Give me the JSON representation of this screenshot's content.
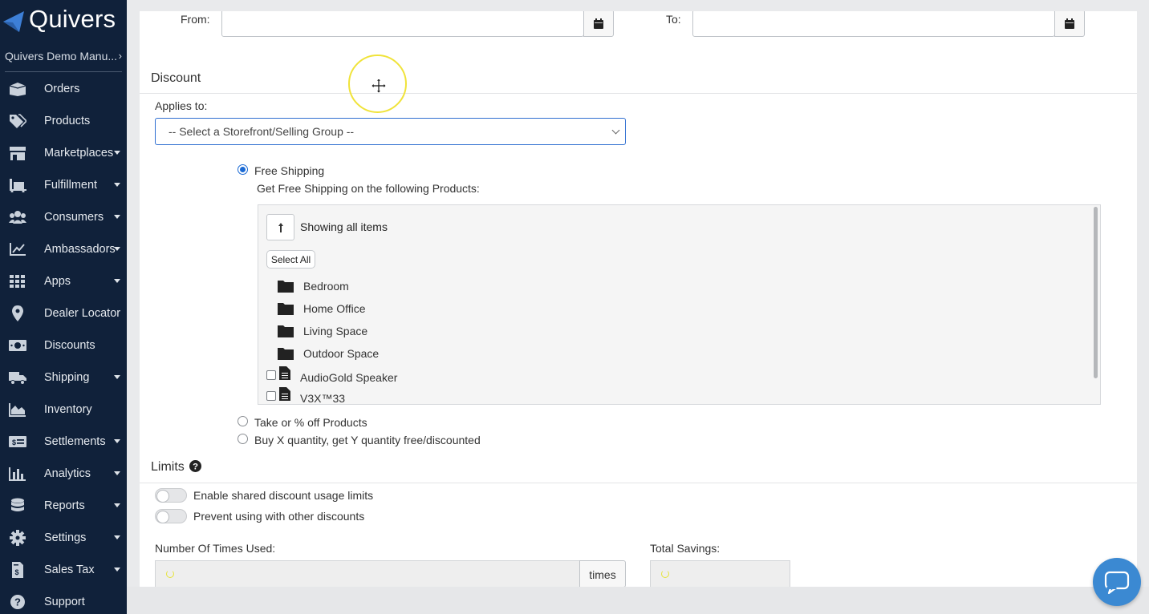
{
  "app": {
    "name": "Quivers",
    "account": "Quivers Demo Manu...",
    "account_chevron": "›"
  },
  "nav": [
    {
      "label": "Orders",
      "icon": "box-open-icon",
      "caret": false
    },
    {
      "label": "Products",
      "icon": "tags-icon",
      "caret": false
    },
    {
      "label": "Marketplaces",
      "icon": "store-icon",
      "caret": true
    },
    {
      "label": "Fulfillment",
      "icon": "pallet-icon",
      "caret": true
    },
    {
      "label": "Consumers",
      "icon": "users-icon",
      "caret": true
    },
    {
      "label": "Ambassadors",
      "icon": "chart-line-icon",
      "caret": true
    },
    {
      "label": "Apps",
      "icon": "grid-icon",
      "caret": true
    },
    {
      "label": "Dealer Locator",
      "icon": "map-pin-icon",
      "caret": false
    },
    {
      "label": "Discounts",
      "icon": "money-bill-icon",
      "caret": false
    },
    {
      "label": "Shipping",
      "icon": "truck-icon",
      "caret": true
    },
    {
      "label": "Inventory",
      "icon": "area-chart-icon",
      "caret": false
    },
    {
      "label": "Settlements",
      "icon": "money-check-icon",
      "caret": true
    },
    {
      "label": "Analytics",
      "icon": "bar-chart-icon",
      "caret": true
    },
    {
      "label": "Reports",
      "icon": "database-icon",
      "caret": true
    },
    {
      "label": "Settings",
      "icon": "gear-icon",
      "caret": true
    },
    {
      "label": "Sales Tax",
      "icon": "file-invoice-dollar-icon",
      "caret": true
    },
    {
      "label": "Support",
      "icon": "question-circle-icon",
      "caret": false
    }
  ],
  "dates": {
    "from_label": "From:",
    "to_label": "To:",
    "from_value": "",
    "to_value": ""
  },
  "discount": {
    "title": "Discount",
    "applies_to_label": "Applies to:",
    "applies_to_selected": "-- Select a Storefront/Selling Group --",
    "options": [
      {
        "label": "Free Shipping",
        "checked": true
      },
      {
        "label": "Take or % off Products",
        "checked": false
      },
      {
        "label": "Buy X quantity, get Y quantity free/discounted",
        "checked": false
      }
    ],
    "free_shipping_caption": "Get Free Shipping on the following Products:"
  },
  "browser": {
    "showing_label": "Showing all items",
    "select_all_label": "Select All",
    "folders": [
      "Bedroom",
      "Home Office",
      "Living Space",
      "Outdoor Space"
    ],
    "files": [
      {
        "name": "AudioGold Speaker",
        "checked": false
      },
      {
        "name": "V3X™33",
        "checked": false
      }
    ]
  },
  "limits": {
    "title": "Limits",
    "toggles": [
      {
        "label": "Enable shared discount usage limits",
        "on": false
      },
      {
        "label": "Prevent using with other discounts",
        "on": false
      }
    ],
    "times_used_label": "Number Of Times Used:",
    "times_unit": "times",
    "total_savings_label": "Total Savings:"
  },
  "colors": {
    "sidebar_bg": "#10213a",
    "accent": "#1b6ad4",
    "chat_bg": "#3b89d2"
  }
}
